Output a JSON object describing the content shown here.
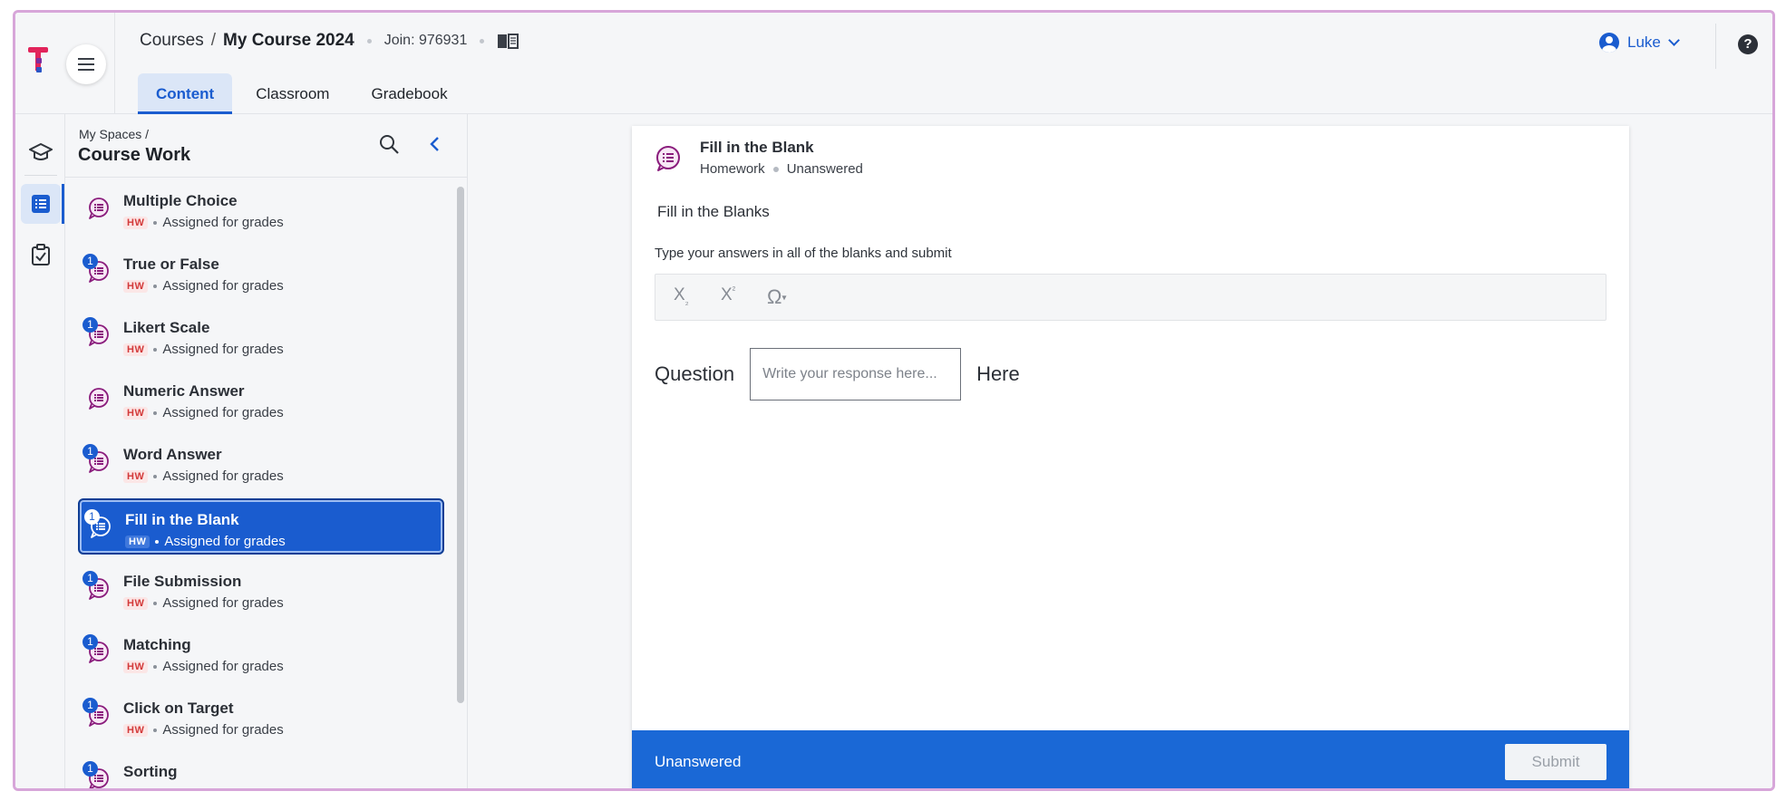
{
  "header": {
    "breadcrumb_courses": "Courses",
    "breadcrumb_sep": "/",
    "course_name": "My Course 2024",
    "join_label": "Join: 976931",
    "tabs": [
      {
        "label": "Content",
        "active": true
      },
      {
        "label": "Classroom",
        "active": false
      },
      {
        "label": "Gradebook",
        "active": false
      }
    ],
    "user_name": "Luke",
    "help_label": "?"
  },
  "rail": {
    "icons": [
      "graduation-cap-icon",
      "list-icon",
      "checklist-icon"
    ]
  },
  "sidebar": {
    "crumb": "My Spaces /",
    "title": "Course Work",
    "items": [
      {
        "name": "Multiple Choice",
        "tag": "HW",
        "status": "Assigned for grades",
        "badge": ""
      },
      {
        "name": "True or False",
        "tag": "HW",
        "status": "Assigned for grades",
        "badge": "1"
      },
      {
        "name": "Likert Scale",
        "tag": "HW",
        "status": "Assigned for grades",
        "badge": "1"
      },
      {
        "name": "Numeric Answer",
        "tag": "HW",
        "status": "Assigned for grades",
        "badge": ""
      },
      {
        "name": "Word Answer",
        "tag": "HW",
        "status": "Assigned for grades",
        "badge": "1"
      },
      {
        "name": "Fill in the Blank",
        "tag": "HW",
        "status": "Assigned for grades",
        "badge": "1",
        "active": true
      },
      {
        "name": "File Submission",
        "tag": "HW",
        "status": "Assigned for grades",
        "badge": "1"
      },
      {
        "name": "Matching",
        "tag": "HW",
        "status": "Assigned for grades",
        "badge": "1"
      },
      {
        "name": "Click on Target",
        "tag": "HW",
        "status": "Assigned for grades",
        "badge": "1"
      },
      {
        "name": "Sorting",
        "tag": "",
        "status": "",
        "badge": "1"
      }
    ]
  },
  "question": {
    "title": "Fill in the Blank",
    "type": "Homework",
    "answer_state": "Unanswered",
    "section_title": "Fill in the Blanks",
    "instructions": "Type your answers in all of the blanks and submit",
    "toolbar": {
      "subscript": "X",
      "subscript_mark": "₂",
      "superscript": "X",
      "superscript_mark": "²",
      "special_char": "Ω"
    },
    "prefix_text": "Question",
    "input_placeholder": "Write your response here...",
    "input_value": "",
    "suffix_text": "Here"
  },
  "footer": {
    "status": "Unanswered",
    "submit_label": "Submit"
  },
  "colors": {
    "accent": "#1a5ccf",
    "footer_bg": "#1a68d6",
    "hw_tag": "#d33a3a",
    "question_icon": "#8a1c7c",
    "frame_border": "#d7a6d9"
  }
}
